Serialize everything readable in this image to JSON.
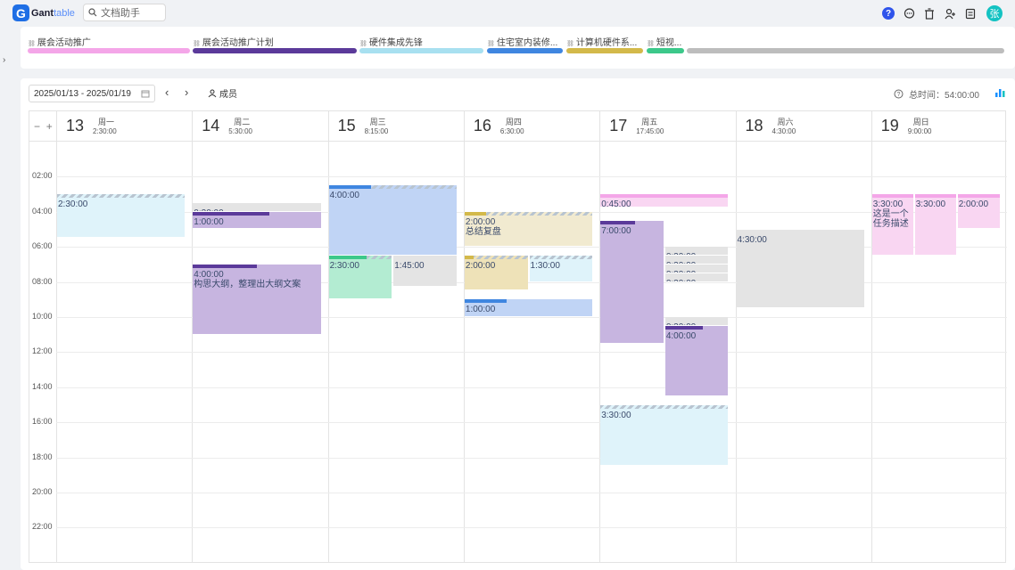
{
  "app": {
    "logo_letter": "G",
    "name_main": "Gant",
    "name_accent": "table"
  },
  "search": {
    "label": "文档助手"
  },
  "user": {
    "avatar": "张"
  },
  "projects": [
    {
      "label": "展会活动推广",
      "color": "#f4a6e8",
      "icon": "link-icon"
    },
    {
      "label": "展会活动推广计划",
      "color": "#5b3a9a",
      "icon": "link-icon"
    },
    {
      "label": "硬件集成先锋",
      "color": "#a8e0f0",
      "icon": "link-icon"
    },
    {
      "label": "住宅室内装修...",
      "color": "#3f86e0",
      "icon": "link-icon"
    },
    {
      "label": "计算机硬件系...",
      "color": "#d3b94a",
      "icon": "link-icon"
    },
    {
      "label": "短视...",
      "color": "#3cc88a",
      "icon": "link-icon"
    },
    {
      "label": "",
      "color": "#bdbdbd",
      "icon": ""
    }
  ],
  "toolbar": {
    "date_range": "2025/01/13 - 2025/01/19",
    "member_label": "成员",
    "total_label": "总时间：54:00:00"
  },
  "zoom": {
    "minus": "−",
    "plus": "+"
  },
  "days": [
    {
      "num": "13",
      "name": "周一",
      "dur": "2:30:00"
    },
    {
      "num": "14",
      "name": "周二",
      "dur": "5:30:00"
    },
    {
      "num": "15",
      "name": "周三",
      "dur": "8:15:00"
    },
    {
      "num": "16",
      "name": "周四",
      "dur": "6:30:00"
    },
    {
      "num": "17",
      "name": "周五",
      "dur": "17:45:00"
    },
    {
      "num": "18",
      "name": "周六",
      "dur": "4:30:00"
    },
    {
      "num": "19",
      "name": "周日",
      "dur": "9:00:00"
    }
  ],
  "hours": [
    "02:00",
    "04:00",
    "06:00",
    "08:00",
    "10:00",
    "12:00",
    "14:00",
    "16:00",
    "18:00",
    "20:00",
    "22:00"
  ],
  "tasks": [
    {
      "day": 0,
      "sub": [
        0,
        1
      ],
      "start": 3.0,
      "dur": 2.5,
      "bg": "#dff3fa",
      "bar": "hatch",
      "label": "2:30:00"
    },
    {
      "day": 1,
      "sub": [
        0,
        1
      ],
      "start": 3.5,
      "dur": 0.5,
      "bg": "#e4e4e4",
      "bar": "none",
      "label": "0:30:00"
    },
    {
      "day": 1,
      "sub": [
        0,
        1
      ],
      "start": 4.0,
      "dur": 1.0,
      "bg": "#c7b5e0",
      "bar": "#5b3a9a",
      "barw": 0.6,
      "label": "1:00:00"
    },
    {
      "day": 1,
      "sub": [
        0,
        1
      ],
      "start": 7.0,
      "dur": 4.0,
      "bg": "#c7b5e0",
      "bar": "#5b3a9a",
      "barw": 0.5,
      "label": "4:00:00\n构思大纲，整理出大纲文案"
    },
    {
      "day": 2,
      "sub": [
        0,
        1
      ],
      "start": 2.5,
      "dur": 4.0,
      "bg": "#c0d4f5",
      "bar": "#3f86e0",
      "barw": 0.33,
      "hatch": true,
      "label": "4:00:00"
    },
    {
      "day": 2,
      "sub": [
        0,
        0.5
      ],
      "start": 6.5,
      "dur": 2.5,
      "bg": "#b3ecd2",
      "bar": "#3cc88a",
      "barw": 0.6,
      "hatch": true,
      "label": "2:30:00"
    },
    {
      "day": 2,
      "sub": [
        0.5,
        1
      ],
      "start": 6.5,
      "dur": 1.75,
      "bg": "#e4e4e4",
      "bar": "none",
      "label": "1:45:00"
    },
    {
      "day": 3,
      "sub": [
        0,
        1
      ],
      "start": 4.0,
      "dur": 2.0,
      "bg": "#f1ead0",
      "bar": "#d3b94a",
      "barw": 0.17,
      "hatch": true,
      "label": "2:00:00\n总结复盘"
    },
    {
      "day": 3,
      "sub": [
        0,
        0.5
      ],
      "start": 6.5,
      "dur": 2.0,
      "bg": "#eee2b8",
      "bar": "#d3b94a",
      "barw": 0.15,
      "hatch": true,
      "label": "2:00:00"
    },
    {
      "day": 3,
      "sub": [
        0.5,
        1
      ],
      "start": 6.5,
      "dur": 1.5,
      "bg": "#dff3fa",
      "bar": "hatch",
      "label": "1:30:00"
    },
    {
      "day": 3,
      "sub": [
        0,
        1
      ],
      "start": 9.0,
      "dur": 1.0,
      "bg": "#c0d4f5",
      "bar": "#3f86e0",
      "barw": 0.33,
      "label": "1:00:00"
    },
    {
      "day": 4,
      "sub": [
        0,
        1
      ],
      "start": 3.0,
      "dur": 0.75,
      "bg": "#f9d6f2",
      "bar": "#f4a6e8",
      "barw": 1.0,
      "label": "0:45:00"
    },
    {
      "day": 4,
      "sub": [
        0,
        0.5
      ],
      "start": 4.5,
      "dur": 7.0,
      "bg": "#c7b5e0",
      "bar": "#5b3a9a",
      "barw": 0.55,
      "label": "7:00:00"
    },
    {
      "day": 4,
      "sub": [
        0.5,
        1
      ],
      "start": 6.0,
      "dur": 0.5,
      "bg": "#e4e4e4",
      "bar": "none",
      "label": "0:30:00"
    },
    {
      "day": 4,
      "sub": [
        0.5,
        1
      ],
      "start": 6.5,
      "dur": 0.5,
      "bg": "#e4e4e4",
      "bar": "none",
      "label": "0:30:00"
    },
    {
      "day": 4,
      "sub": [
        0.5,
        1
      ],
      "start": 7.0,
      "dur": 0.5,
      "bg": "#e4e4e4",
      "bar": "none",
      "label": "0:30:00"
    },
    {
      "day": 4,
      "sub": [
        0.5,
        1
      ],
      "start": 7.5,
      "dur": 0.5,
      "bg": "#e4e4e4",
      "bar": "none",
      "label": "0:30:00"
    },
    {
      "day": 4,
      "sub": [
        0.5,
        1
      ],
      "start": 10.0,
      "dur": 0.5,
      "bg": "#e4e4e4",
      "bar": "none",
      "label": "0:30:00"
    },
    {
      "day": 4,
      "sub": [
        0.5,
        1
      ],
      "start": 10.5,
      "dur": 4.0,
      "bg": "#c7b5e0",
      "bar": "#5b3a9a",
      "barw": 0.6,
      "label": "4:00:00"
    },
    {
      "day": 4,
      "sub": [
        0,
        1
      ],
      "start": 15.0,
      "dur": 3.5,
      "bg": "#dff3fa",
      "bar": "hatch",
      "label": "3:30:00"
    },
    {
      "day": 5,
      "sub": [
        0,
        1
      ],
      "start": 5.0,
      "dur": 4.5,
      "bg": "#e4e4e4",
      "bar": "none",
      "label": "4:30:00"
    },
    {
      "day": 6,
      "sub": [
        0,
        0.33
      ],
      "start": 3.0,
      "dur": 3.5,
      "bg": "#f9d6f2",
      "bar": "#f4a6e8",
      "barw": 1.0,
      "label": "3:30:00\n这是一个任务描述"
    },
    {
      "day": 6,
      "sub": [
        0.33,
        0.66
      ],
      "start": 3.0,
      "dur": 3.5,
      "bg": "#f9d6f2",
      "bar": "#f4a6e8",
      "barw": 1.0,
      "label": "3:30:00"
    },
    {
      "day": 6,
      "sub": [
        0.66,
        1
      ],
      "start": 3.0,
      "dur": 2.0,
      "bg": "#f9d6f2",
      "bar": "#f4a6e8",
      "barw": 1.0,
      "label": "2:00:00"
    }
  ]
}
